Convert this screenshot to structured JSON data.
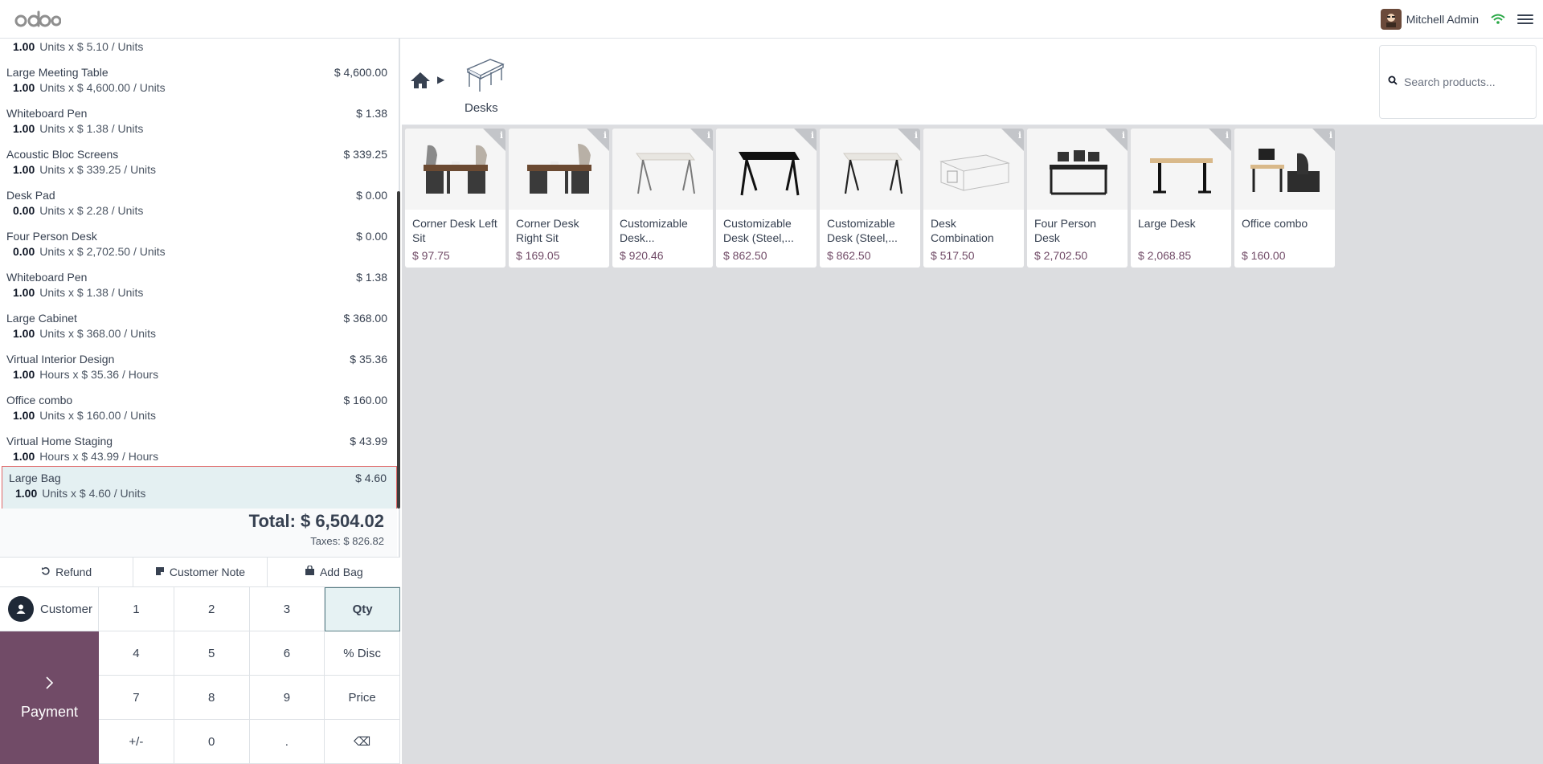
{
  "header": {
    "app_name": "odoo",
    "user_name": "Mitchell Admin"
  },
  "orderlines": [
    {
      "name": "",
      "price": "",
      "qty": "1.00",
      "unit_text": "Units x $ 5.10 / Units"
    },
    {
      "name": "Large Meeting Table",
      "price": "$ 4,600.00",
      "qty": "1.00",
      "unit_text": "Units x $ 4,600.00 / Units"
    },
    {
      "name": "Whiteboard Pen",
      "price": "$ 1.38",
      "qty": "1.00",
      "unit_text": "Units x $ 1.38 / Units"
    },
    {
      "name": "Acoustic Bloc Screens",
      "price": "$ 339.25",
      "qty": "1.00",
      "unit_text": "Units x $ 339.25 / Units"
    },
    {
      "name": "Desk Pad",
      "price": "$ 0.00",
      "qty": "0.00",
      "unit_text": "Units x $ 2.28 / Units"
    },
    {
      "name": "Four Person Desk",
      "price": "$ 0.00",
      "qty": "0.00",
      "unit_text": "Units x $ 2,702.50 / Units"
    },
    {
      "name": "Whiteboard Pen",
      "price": "$ 1.38",
      "qty": "1.00",
      "unit_text": "Units x $ 1.38 / Units"
    },
    {
      "name": "Large Cabinet",
      "price": "$ 368.00",
      "qty": "1.00",
      "unit_text": "Units x $ 368.00 / Units"
    },
    {
      "name": "Virtual Interior Design",
      "price": "$ 35.36",
      "qty": "1.00",
      "unit_text": "Hours x $ 35.36 / Hours"
    },
    {
      "name": "Office combo",
      "price": "$ 160.00",
      "qty": "1.00",
      "unit_text": "Units x $ 160.00 / Units"
    },
    {
      "name": "Virtual Home Staging",
      "price": "$ 43.99",
      "qty": "1.00",
      "unit_text": "Hours x $ 43.99 / Hours"
    },
    {
      "name": "Large Bag",
      "price": "$ 4.60",
      "qty": "1.00",
      "unit_text": "Units x $ 4.60 / Units"
    }
  ],
  "totals": {
    "total": "Total: $ 6,504.02",
    "taxes": "Taxes: $ 826.82"
  },
  "actions": {
    "refund": "Refund",
    "customer_note": "Customer Note",
    "add_bag": "Add Bag"
  },
  "pad": {
    "customer": "Customer",
    "payment": "Payment",
    "keys": [
      "1",
      "2",
      "3",
      "Qty",
      "4",
      "5",
      "6",
      "% Disc",
      "7",
      "8",
      "9",
      "Price",
      "+/-",
      "0",
      ".",
      "⌫"
    ]
  },
  "breadcrumb": {
    "category": "Desks"
  },
  "search": {
    "placeholder": "Search products..."
  },
  "products": [
    {
      "name": "Corner Desk Left Sit",
      "price": "$ 97.75",
      "image": "dark-corner-desk"
    },
    {
      "name": "Corner Desk Right Sit",
      "price": "$ 169.05",
      "image": "dark-corner-desk"
    },
    {
      "name": "Customizable Desk...",
      "price": "$ 920.46",
      "image": "white-desk"
    },
    {
      "name": "Customizable Desk (Steel,...",
      "price": "$ 862.50",
      "image": "black-desk"
    },
    {
      "name": "Customizable Desk (Steel,...",
      "price": "$ 862.50",
      "image": "white-desk"
    },
    {
      "name": "Desk Combination",
      "price": "$ 517.50",
      "image": "combo-desk"
    },
    {
      "name": "Four Person Desk",
      "price": "$ 2,702.50",
      "image": "four-desk"
    },
    {
      "name": "Large Desk",
      "price": "$ 2,068.85",
      "image": "large-desk"
    },
    {
      "name": "Office combo",
      "price": "$ 160.00",
      "image": "office-combo"
    }
  ],
  "colors": {
    "brand": "#714b67",
    "selected_bg": "#e4f0f2",
    "selected_border": "#e06666",
    "wifi": "#28a745"
  }
}
